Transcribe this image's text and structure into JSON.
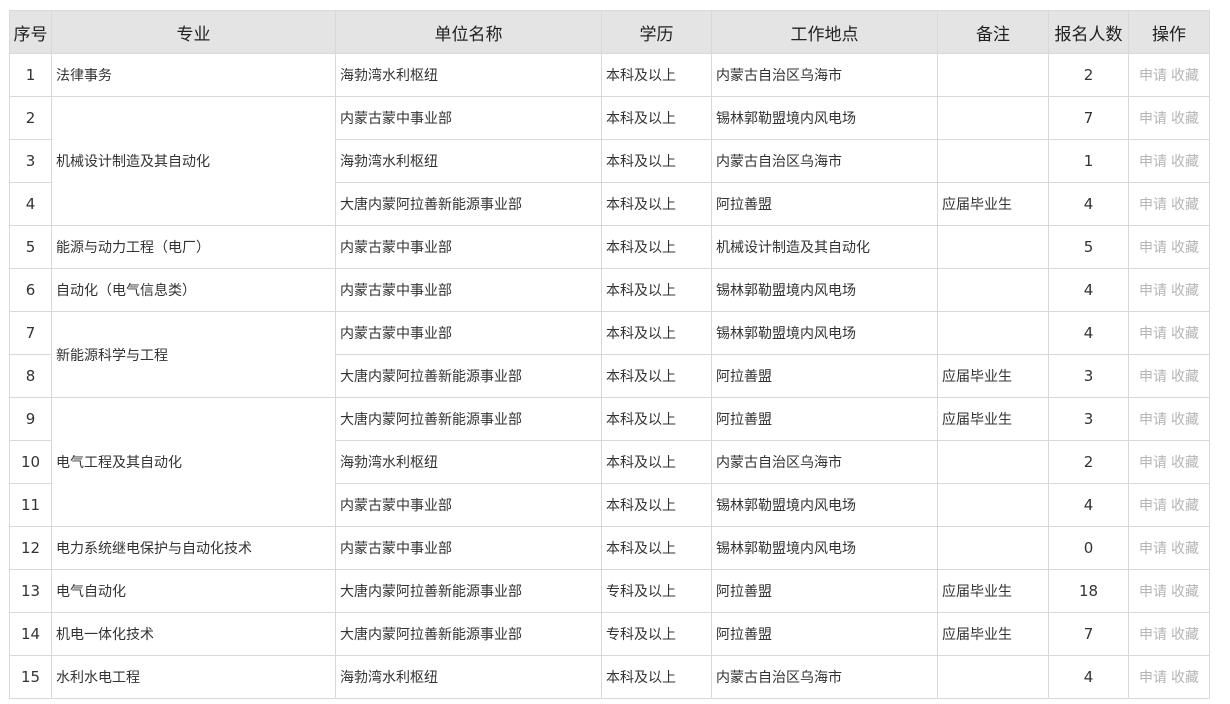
{
  "headers": {
    "idx": "序号",
    "major": "专业",
    "unit": "单位名称",
    "edu": "学历",
    "loc": "工作地点",
    "note": "备注",
    "count": "报名人数",
    "ops": "操作"
  },
  "actions": {
    "apply": "申请",
    "fav": "收藏"
  },
  "rows": [
    {
      "idx": "1",
      "major": "法律事务",
      "unit": "海勃湾水利枢纽",
      "edu": "本科及以上",
      "loc": "内蒙古自治区乌海市",
      "note": "",
      "count": "2"
    },
    {
      "idx": "2",
      "major": "机械设计制造及其自动化",
      "unit": "内蒙古蒙中事业部",
      "edu": "本科及以上",
      "loc": "锡林郭勒盟境内风电场",
      "note": "",
      "count": "7"
    },
    {
      "idx": "3",
      "unit": "海勃湾水利枢纽",
      "edu": "本科及以上",
      "loc": "内蒙古自治区乌海市",
      "note": "",
      "count": "1"
    },
    {
      "idx": "4",
      "unit": "大唐内蒙阿拉善新能源事业部",
      "edu": "本科及以上",
      "loc": "阿拉善盟",
      "note": "应届毕业生",
      "count": "4"
    },
    {
      "idx": "5",
      "major": "能源与动力工程（电厂）",
      "unit": "内蒙古蒙中事业部",
      "edu": "本科及以上",
      "loc": "机械设计制造及其自动化",
      "note": "",
      "count": "5"
    },
    {
      "idx": "6",
      "major": "自动化（电气信息类）",
      "unit": "内蒙古蒙中事业部",
      "edu": "本科及以上",
      "loc": "锡林郭勒盟境内风电场",
      "note": "",
      "count": "4"
    },
    {
      "idx": "7",
      "major": "新能源科学与工程",
      "unit": "内蒙古蒙中事业部",
      "edu": "本科及以上",
      "loc": "锡林郭勒盟境内风电场",
      "note": "",
      "count": "4"
    },
    {
      "idx": "8",
      "unit": "大唐内蒙阿拉善新能源事业部",
      "edu": "本科及以上",
      "loc": "阿拉善盟",
      "note": "应届毕业生",
      "count": "3"
    },
    {
      "idx": "9",
      "major": "电气工程及其自动化",
      "unit": "大唐内蒙阿拉善新能源事业部",
      "edu": "本科及以上",
      "loc": "阿拉善盟",
      "note": "应届毕业生",
      "count": "3"
    },
    {
      "idx": "10",
      "unit": "海勃湾水利枢纽",
      "edu": "本科及以上",
      "loc": "内蒙古自治区乌海市",
      "note": "",
      "count": "2"
    },
    {
      "idx": "11",
      "unit": "内蒙古蒙中事业部",
      "edu": "本科及以上",
      "loc": "锡林郭勒盟境内风电场",
      "note": "",
      "count": "4"
    },
    {
      "idx": "12",
      "major": "电力系统继电保护与自动化技术",
      "unit": "内蒙古蒙中事业部",
      "edu": "本科及以上",
      "loc": "锡林郭勒盟境内风电场",
      "note": "",
      "count": "0"
    },
    {
      "idx": "13",
      "major": "电气自动化",
      "unit": "大唐内蒙阿拉善新能源事业部",
      "edu": "专科及以上",
      "loc": "阿拉善盟",
      "note": "应届毕业生",
      "count": "18"
    },
    {
      "idx": "14",
      "major": "机电一体化技术",
      "unit": "大唐内蒙阿拉善新能源事业部",
      "edu": "专科及以上",
      "loc": "阿拉善盟",
      "note": "应届毕业生",
      "count": "7"
    },
    {
      "idx": "15",
      "major": "水利水电工程",
      "unit": "海勃湾水利枢纽",
      "edu": "本科及以上",
      "loc": "内蒙古自治区乌海市",
      "note": "",
      "count": "4"
    }
  ]
}
